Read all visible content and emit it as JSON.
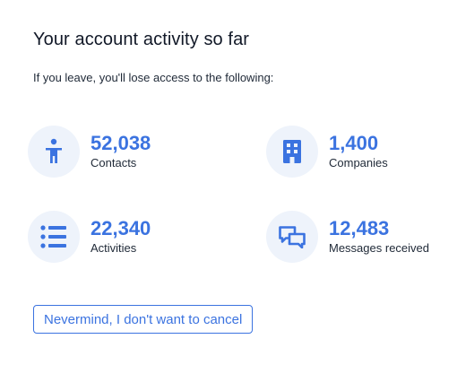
{
  "title": "Your account activity so far",
  "subtitle": "If you leave, you'll lose access to the following:",
  "accent_color": "#3b73e0",
  "icon_bg_color": "#eef3fb",
  "stats": [
    {
      "value": "52,038",
      "label": "Contacts",
      "icon": "person-icon"
    },
    {
      "value": "1,400",
      "label": "Companies",
      "icon": "building-icon"
    },
    {
      "value": "22,340",
      "label": "Activities",
      "icon": "list-icon"
    },
    {
      "value": "12,483",
      "label": "Messages received",
      "icon": "chat-icon"
    }
  ],
  "cancel_button": {
    "label": "Nevermind, I don't want to cancel"
  }
}
